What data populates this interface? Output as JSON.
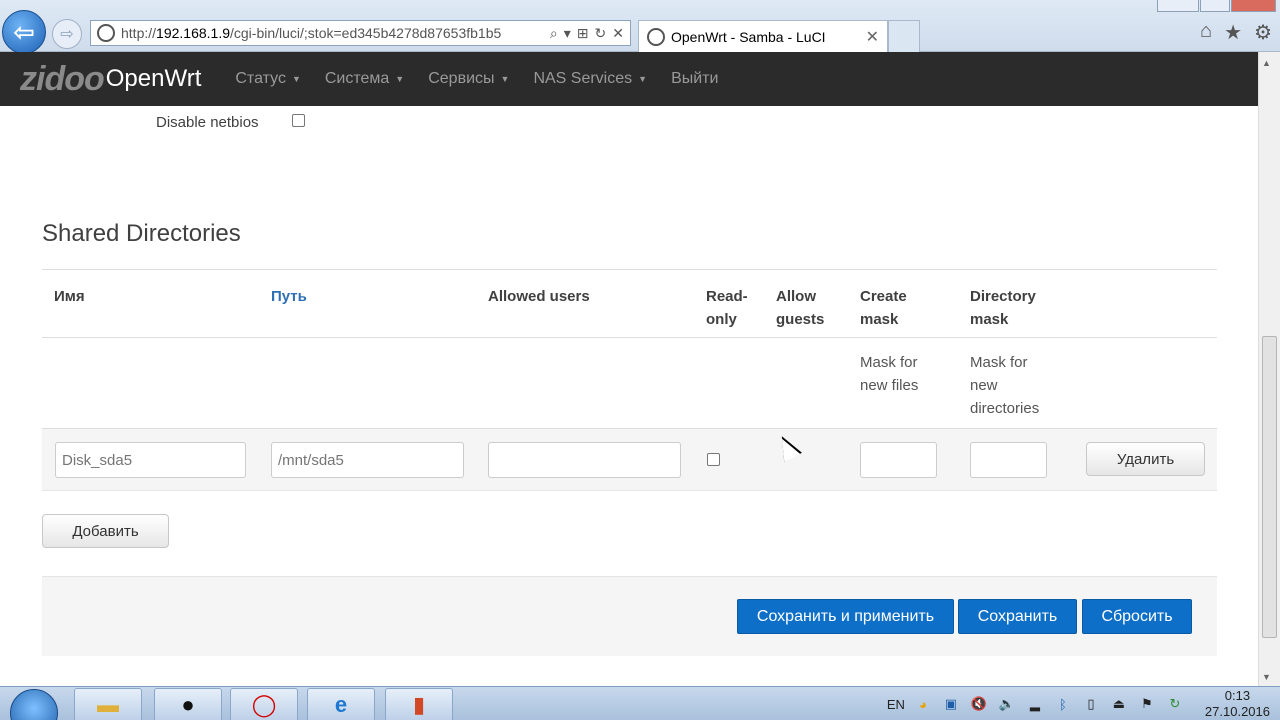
{
  "browser": {
    "url_prefix": "http://",
    "url_host": "192.168.1.9",
    "url_rest": "/cgi-bin/luci/;stok=ed345b4278d87653fb1b5",
    "tab_title": "OpenWrt - Samba - LuCI",
    "tab_close": "✕",
    "addr_tools": [
      "⌕",
      "▾",
      "⊞",
      "↻",
      "✕"
    ],
    "back_glyph": "⇦",
    "forward_glyph": "⇨",
    "right_icons": [
      "⌂",
      "★",
      "⚙"
    ]
  },
  "header": {
    "brand_zidoo": "zidoo",
    "brand_openwrt": "OpenWrt",
    "menu": [
      {
        "label": "Статус",
        "has_caret": true
      },
      {
        "label": "Система",
        "has_caret": true
      },
      {
        "label": "Сервисы",
        "has_caret": true
      },
      {
        "label": "NAS Services",
        "has_caret": true
      },
      {
        "label": "Выйти",
        "has_caret": false
      }
    ],
    "caret": "▼"
  },
  "settings": {
    "disable_netbios_label": "Disable netbios",
    "disable_netbios_checked": false
  },
  "shared": {
    "title": "Shared Directories",
    "columns": {
      "name": "Имя",
      "path": "Путь",
      "allowed_users": "Allowed users",
      "read_only_1": "Read-",
      "read_only_2": "only",
      "allow_guests_1": "Allow",
      "allow_guests_2": "guests",
      "create_mask_1": "Create",
      "create_mask_2": "mask",
      "dir_mask_1": "Directory",
      "dir_mask_2": "mask"
    },
    "descriptions": {
      "create_mask_1": "Mask for",
      "create_mask_2": "new files",
      "dir_mask_1": "Mask for",
      "dir_mask_2": "new",
      "dir_mask_3": "directories"
    },
    "row": {
      "name_placeholder": "Disk_sda5",
      "path_placeholder": "/mnt/sda5",
      "allowed_users": "",
      "read_only": false,
      "create_mask": "",
      "dir_mask": "",
      "delete_label": "Удалить"
    },
    "add_label": "Добавить"
  },
  "footer": {
    "save_apply": "Сохранить и применить",
    "save": "Сохранить",
    "reset": "Сбросить"
  },
  "taskbar": {
    "lang": "EN",
    "time": "0:13",
    "date": "27.10.2016"
  },
  "colors": {
    "header_bg": "#2b2b2b",
    "primary_button": "#0d6fc7",
    "link": "#2f6fb4"
  }
}
